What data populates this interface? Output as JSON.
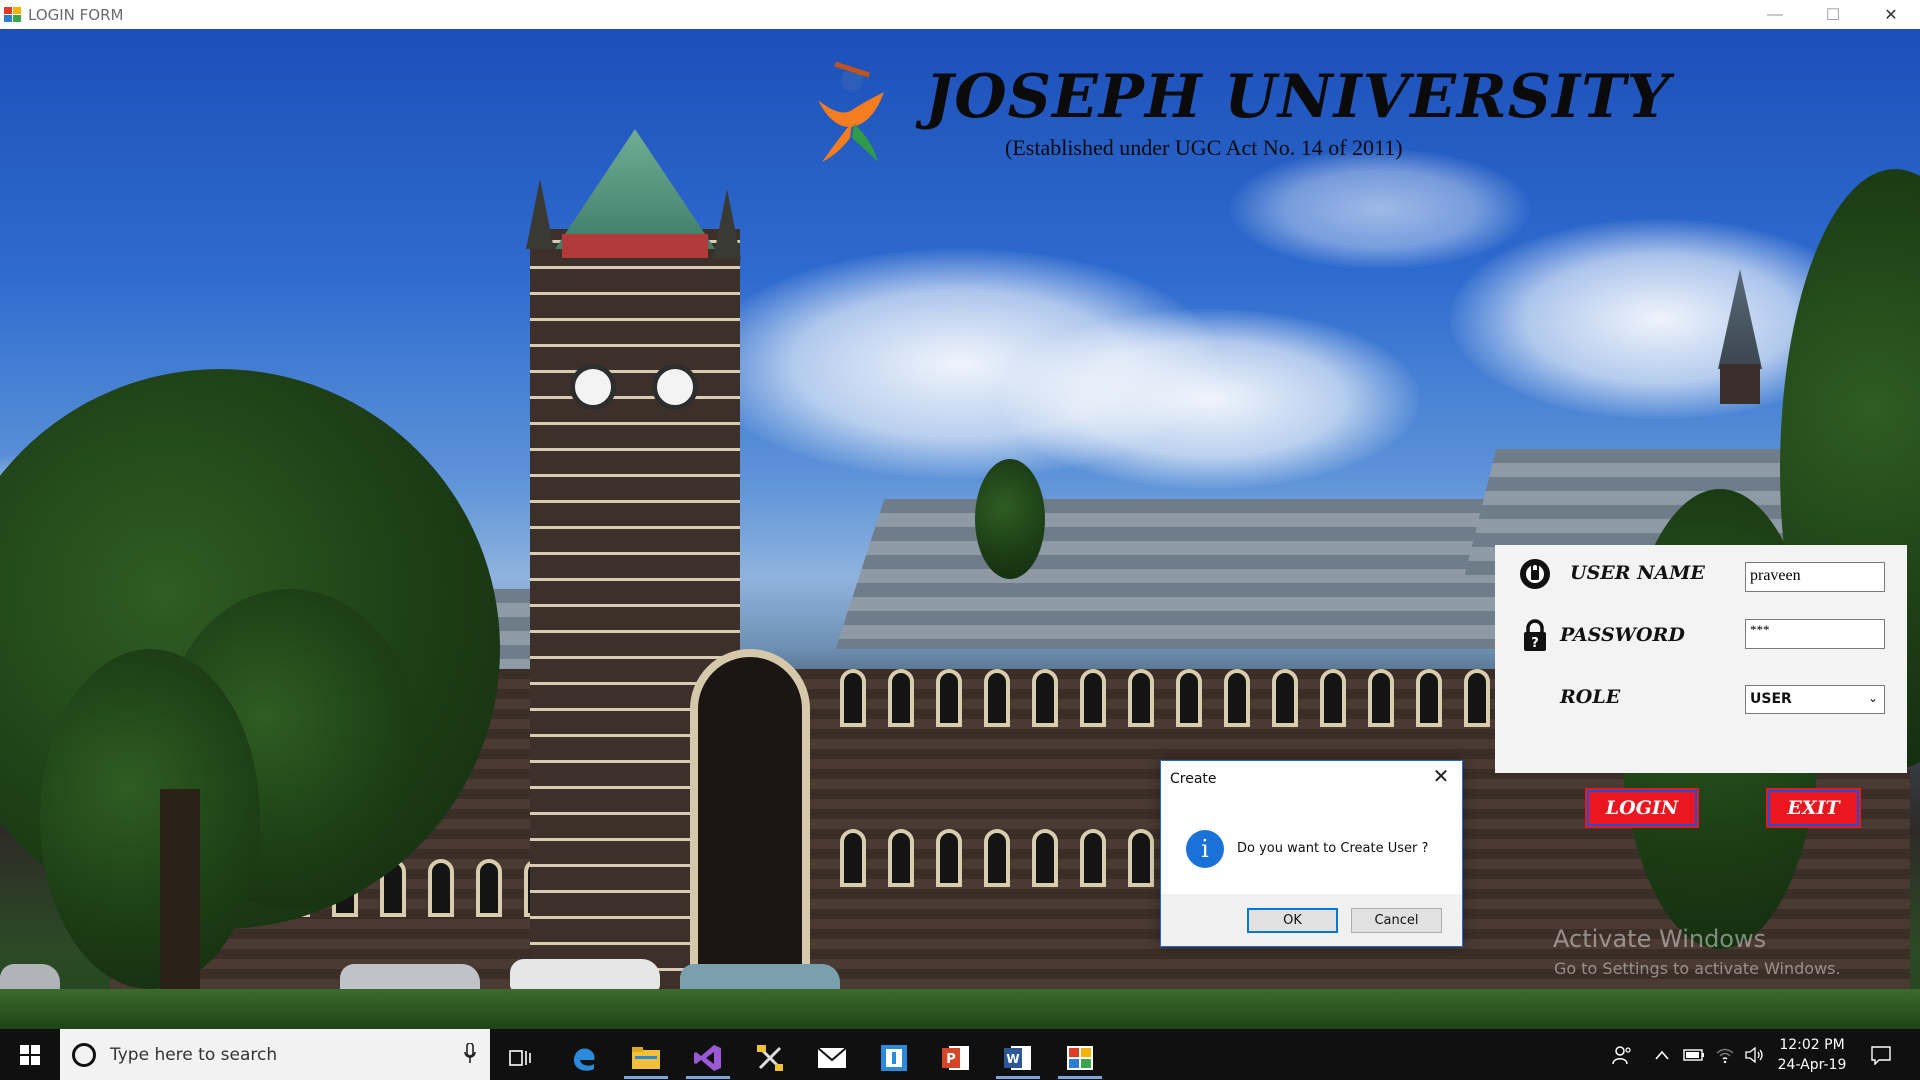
{
  "window": {
    "title": "LOGIN FORM",
    "controls": {
      "minimize": "—",
      "maximize": "☐",
      "close": "✕"
    }
  },
  "header": {
    "university_name": "JOSEPH UNIVERSITY",
    "subtitle": "(Established under UGC Act No. 14 of 2011)",
    "logo_icon": "university-emblem-icon"
  },
  "login": {
    "username_label": "USER NAME",
    "username_value": "praveen",
    "password_label": "PASSWORD",
    "password_value": "***",
    "role_label": "ROLE",
    "role_value": "USER",
    "login_button": "LOGIN",
    "exit_button": "EXIT",
    "colors": {
      "button_fill": "#ea1620",
      "button_border": "#1d52d4",
      "panel_bg": "#f3f3f3"
    }
  },
  "dialog": {
    "title": "Create",
    "message": "Do you want to Create User ?",
    "ok_label": "OK",
    "cancel_label": "Cancel",
    "icon": "info-icon"
  },
  "watermark": {
    "line1": "Activate Windows",
    "line2": "Go to Settings to activate Windows."
  },
  "taskbar": {
    "search_placeholder": "Type here to search",
    "time": "12:02 PM",
    "date": "24-Apr-19",
    "pinned": [
      "task-view-icon",
      "edge-icon",
      "file-explorer-icon",
      "visual-studio-icon",
      "tools-icon",
      "mail-icon",
      "app-icon",
      "powerpoint-icon",
      "word-icon",
      "winforms-app-icon"
    ]
  }
}
